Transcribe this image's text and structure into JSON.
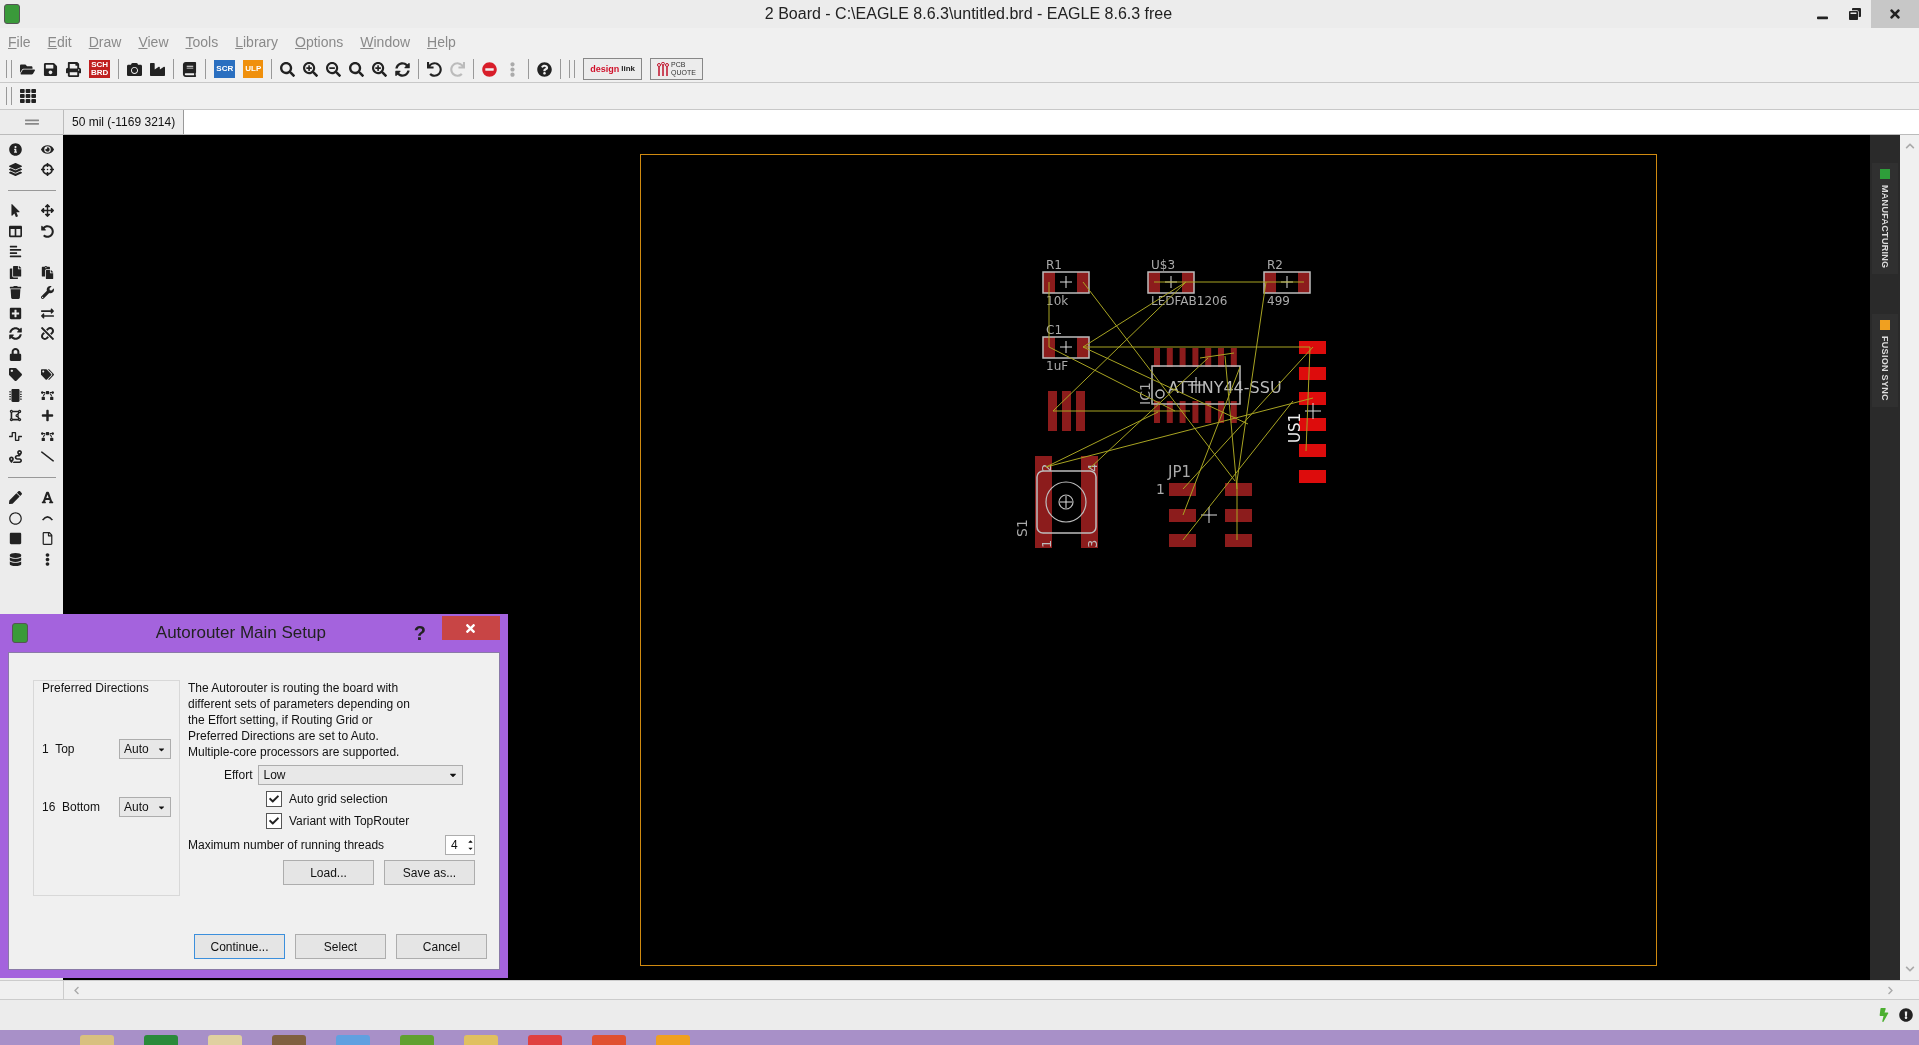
{
  "window": {
    "title": "2 Board - C:\\EAGLE 8.6.3\\untitled.brd - EAGLE 8.6.3 free"
  },
  "menu": [
    "File",
    "Edit",
    "Draw",
    "View",
    "Tools",
    "Library",
    "Options",
    "Window",
    "Help"
  ],
  "toolbar": {
    "sch_brd": {
      "top": "SCH",
      "bottom": "BRD"
    },
    "script": "SCR",
    "ulp": "ULP",
    "design_link": {
      "part_1": "design",
      "part_2": "link"
    },
    "pcb_quote": {
      "top": "PCB",
      "bottom": "QUOTE"
    }
  },
  "coordinates": "50 mil (-1169 3214)",
  "board": {
    "parts": [
      {
        "kind": "smd",
        "name": "R1",
        "value": "10k"
      },
      {
        "kind": "smd",
        "name": "U$3",
        "value": "LEDFAB1206"
      },
      {
        "kind": "smd",
        "name": "R2",
        "value": "499"
      },
      {
        "kind": "smd",
        "name": "C1",
        "value": "1uF"
      },
      {
        "kind": "ic",
        "name": "IC1",
        "value": "ATTINY44-SSU"
      },
      {
        "kind": "connector",
        "name": "US1"
      },
      {
        "kind": "switch",
        "name": "S1",
        "pins": [
          "2",
          "4",
          "1",
          "3"
        ]
      },
      {
        "kind": "header",
        "name": "JP1",
        "pins": [
          "1"
        ]
      }
    ]
  },
  "side_panels": [
    {
      "label": "MANUFACTURING",
      "color": "#2e9e3a"
    },
    {
      "label": "FUSION SYNC",
      "color": "#f0a020"
    }
  ],
  "dialog": {
    "title": "Autorouter Main Setup",
    "help": "?",
    "group": {
      "title": "Preferred Directions",
      "layers": [
        {
          "number": "1",
          "name": "Top",
          "direction": "Auto"
        },
        {
          "number": "16",
          "name": "Bottom",
          "direction": "Auto"
        }
      ]
    },
    "description": "The Autorouter is routing the board with different sets of parameters depending on the Effort setting, if Routing Grid or Preferred Directions are set to Auto. Multiple-core processors are supported.",
    "effort": {
      "label": "Effort",
      "value": "Low"
    },
    "options": [
      {
        "label": "Auto grid selection",
        "checked": true
      },
      {
        "label": "Variant with TopRouter",
        "checked": true
      }
    ],
    "threads": {
      "label": "Maximum number of running threads",
      "value": "4"
    },
    "file_buttons": [
      "Load...",
      "Save as..."
    ],
    "buttons": [
      {
        "label": "Continue...",
        "default": true
      },
      {
        "label": "Select",
        "default": false
      },
      {
        "label": "Cancel",
        "default": false
      }
    ]
  }
}
